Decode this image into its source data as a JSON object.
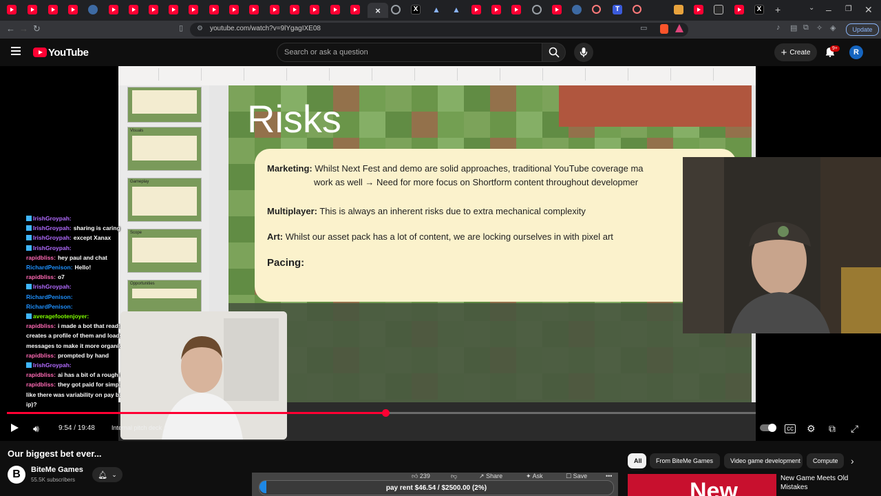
{
  "browser": {
    "url": "youtube.com/watch?v=9lYgagIXE08",
    "update_label": "Update",
    "active_tab_close": "×",
    "new_tab": "+"
  },
  "youtube": {
    "logo_text": "YouTube",
    "search_placeholder": "Search or ask a question",
    "create_label": "Create",
    "notif_badge": "9+",
    "avatar_letter": "R"
  },
  "slide": {
    "title": "Risks",
    "marketing_label": "Marketing:",
    "marketing_text": "Whilst Next Fest and demo are solid approaches, traditional YouTube coverage ma",
    "marketing_cont": "work as well → Need for more focus on Shortform content throughout developmer",
    "multiplayer_label": "Multiplayer:",
    "multiplayer_text": "This is always an inherent risks due to extra mechanical complexity",
    "art_label": "Art:",
    "art_text": "Whilst our asset pack has a lot of content, we are locking ourselves in with pixel art",
    "pacing_label": "Pacing:",
    "thumbs": [
      "Visuals",
      "Gameplay",
      "Scope",
      "Opportunities"
    ]
  },
  "chat": [
    {
      "user": "IrishGroypah:",
      "msg": "",
      "color": "#b26bff",
      "badge": true
    },
    {
      "user": "IrishGroypah:",
      "msg": "sharing is caring",
      "color": "#b26bff",
      "badge": true
    },
    {
      "user": "IrishGroypah:",
      "msg": "except Xanax",
      "color": "#b26bff",
      "badge": true
    },
    {
      "user": "IrishGroypah:",
      "msg": "",
      "color": "#b26bff",
      "badge": true
    },
    {
      "user": "rapidbliss:",
      "msg": "hey paul and chat",
      "color": "#ff69b4",
      "badge": false
    },
    {
      "user": "RichardPenison:",
      "msg": "Hello!",
      "color": "#1e90ff",
      "badge": false
    },
    {
      "user": "rapidbliss:",
      "msg": "o7",
      "color": "#ff69b4",
      "badge": false
    },
    {
      "user": "IrishGroypah:",
      "msg": "",
      "color": "#b26bff",
      "badge": true
    },
    {
      "user": "RichardPenison:",
      "msg": "",
      "color": "#1e90ff",
      "badge": false
    },
    {
      "user": "RichardPenison:",
      "msg": "",
      "color": "#1e90ff",
      "badge": false
    },
    {
      "user": "averagefootenjoyer:",
      "msg": "",
      "color": "#7fff00",
      "badge": true
    },
    {
      "user": "rapidbliss:",
      "msg": "i made a bot that reads all of a users history in a chat and then",
      "color": "#ff69b4",
      "badge": false
    },
    {
      "user": "",
      "msg": "creates a profile of them and loads into their personality, has timing on",
      "color": "#ffffff",
      "badge": false
    },
    {
      "user": "",
      "msg": "messages to make it more organic",
      "color": "#ffffff",
      "badge": false
    },
    {
      "user": "rapidbliss:",
      "msg": "prompted by hand",
      "color": "#ff69b4",
      "badge": false
    },
    {
      "user": "IrishGroypah:",
      "msg": "",
      "color": "#b26bff",
      "badge": true
    },
    {
      "user": "rapidbliss:",
      "msg": "ai has a bit of a rough time with humor currently imo",
      "color": "#ff69b4",
      "badge": false
    },
    {
      "user": "rapidbliss:",
      "msg": "they got paid for simply having people click a link! and it sounded",
      "color": "#ff69b4",
      "badge": false
    },
    {
      "user": "",
      "msg": "like there was variability on pay based on the sources of traffic (presumably by",
      "color": "#ffffff",
      "badge": false
    },
    {
      "user": "",
      "msg": "ip)?",
      "color": "#ffffff",
      "badge": false
    }
  ],
  "player": {
    "progress_fraction": 0.5053,
    "time_current": "9:54",
    "time_total": "19:48",
    "time_sep": " / ",
    "chapter": "Internal pitch deck",
    "chapter_arrow": "›"
  },
  "video": {
    "title": "Our biggest bet ever...",
    "channel": "BiteMe Games",
    "channel_initial": "B",
    "subscribers": "55.5K subscribers",
    "likes": "239",
    "share_label": "Share",
    "ask_label": "Ask",
    "save_label": "Save",
    "more_label": "•••",
    "pay_rent": "pay rent $46.54 / $2500.00 (2%)",
    "pay_fraction": 0.02
  },
  "chips": [
    "All",
    "From BiteMe Games",
    "Video game development",
    "Compute"
  ],
  "recommended": {
    "title": "New Game Meets Old Mistakes",
    "thumb_text": "New"
  },
  "colors": {
    "yt_red": "#ff0033",
    "accent_blue": "#8ab4f8"
  }
}
